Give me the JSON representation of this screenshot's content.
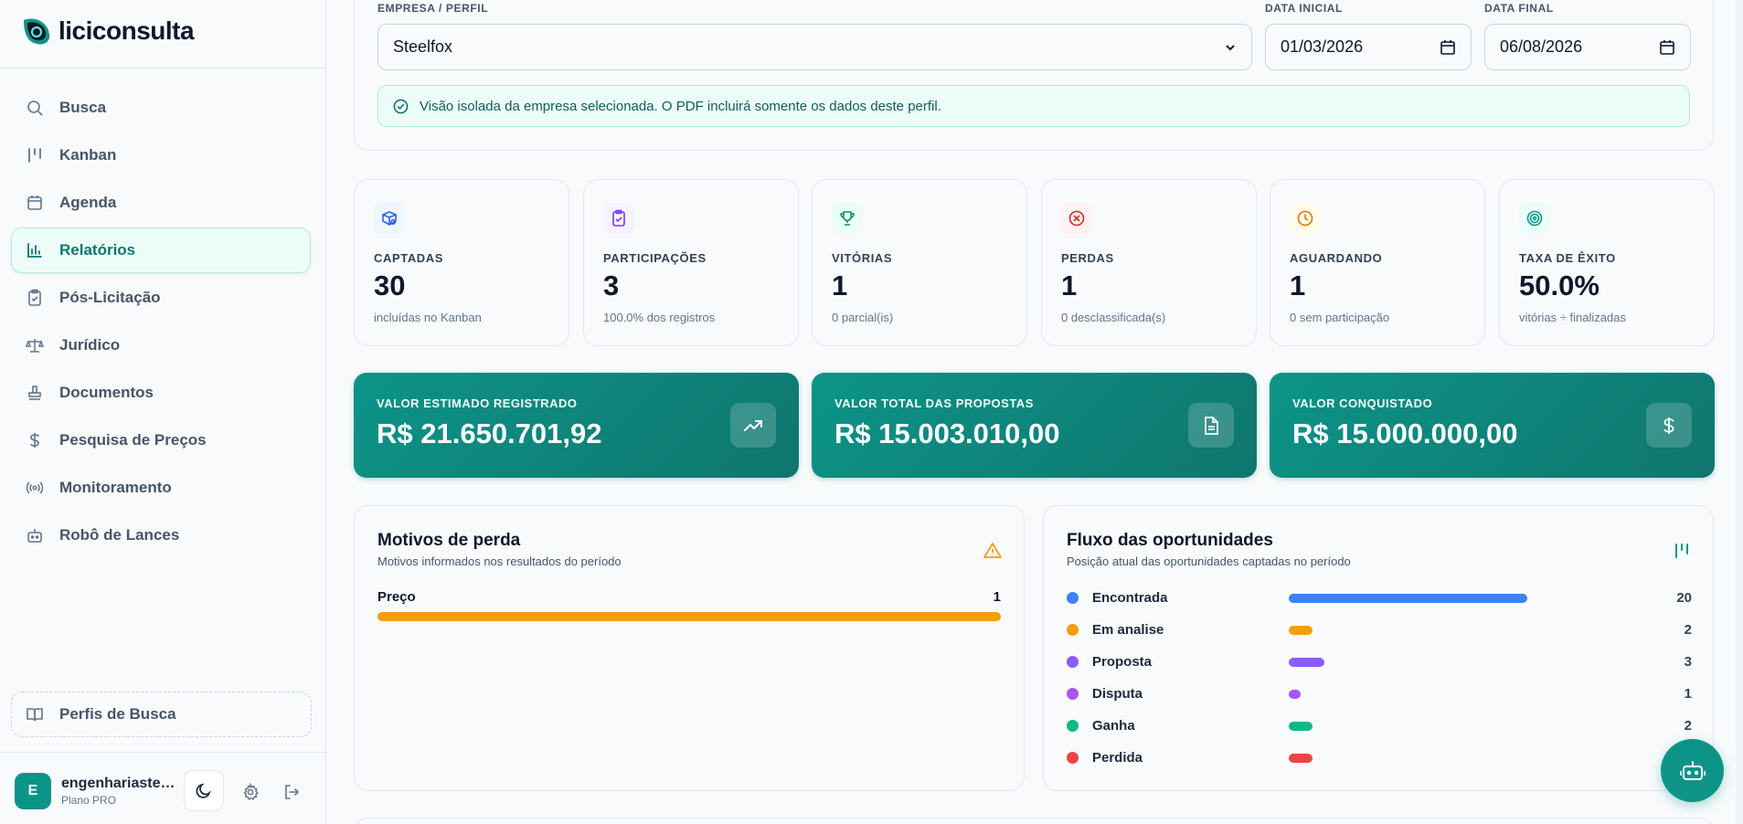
{
  "app": {
    "name": "liciconsulta"
  },
  "sidebar": {
    "items": [
      {
        "label": "Busca",
        "icon": "search-icon"
      },
      {
        "label": "Kanban",
        "icon": "kanban-icon"
      },
      {
        "label": "Agenda",
        "icon": "calendar-icon"
      },
      {
        "label": "Relatórios",
        "icon": "bar-chart-icon",
        "active": true
      },
      {
        "label": "Pós-Licitação",
        "icon": "clipboard-check-icon"
      },
      {
        "label": "Jurídico",
        "icon": "scale-icon"
      },
      {
        "label": "Documentos",
        "icon": "stamp-icon"
      },
      {
        "label": "Pesquisa de Preços",
        "icon": "dollar-icon"
      },
      {
        "label": "Monitoramento",
        "icon": "radio-icon"
      },
      {
        "label": "Robô de Lances",
        "icon": "bot-icon"
      }
    ],
    "perfis_label": "Perfis de Busca"
  },
  "user": {
    "initial": "E",
    "name": "engenhariasteelfox",
    "plan": "Plano PRO"
  },
  "filters": {
    "empresa_label": "EMPRESA / PERFIL",
    "empresa_value": "Steelfox",
    "data_inicial_label": "DATA INICIAL",
    "data_inicial_value": "01/03/2026",
    "data_final_label": "DATA FINAL",
    "data_final_value": "06/08/2026",
    "notice": "Visão isolada da empresa selecionada. O PDF incluirá somente os dados deste perfil."
  },
  "stats": [
    {
      "title": "CAPTADAS",
      "value": "30",
      "sub": "incluídas no Kanban",
      "icon": "package-search-icon",
      "color": "#2563eb",
      "bg": "#eff6ff"
    },
    {
      "title": "PARTICIPAÇÕES",
      "value": "3",
      "sub": "100.0% dos registros",
      "icon": "clipboard-check-icon",
      "color": "#7c3aed",
      "bg": "#f5f3ff"
    },
    {
      "title": "VITÓRIAS",
      "value": "1",
      "sub": "0 parcial(is)",
      "icon": "trophy-icon",
      "color": "#059669",
      "bg": "#ecfdf5"
    },
    {
      "title": "PERDAS",
      "value": "1",
      "sub": "0 desclassificada(s)",
      "icon": "x-circle-icon",
      "color": "#dc2626",
      "bg": "#fef2f2"
    },
    {
      "title": "AGUARDANDO",
      "value": "1",
      "sub": "0 sem participação",
      "icon": "clock-icon",
      "color": "#d97706",
      "bg": "#fffbeb"
    },
    {
      "title": "TAXA DE ÊXITO",
      "value": "50.0%",
      "sub": "vitórias ÷ finalizadas",
      "icon": "target-icon",
      "color": "#0d9488",
      "bg": "#ecfdf8"
    }
  ],
  "money": [
    {
      "title": "VALOR ESTIMADO REGISTRADO",
      "value": "R$ 21.650.701,92",
      "icon": "trending-up-icon"
    },
    {
      "title": "VALOR TOTAL DAS PROPOSTAS",
      "value": "R$ 15.003.010,00",
      "icon": "file-text-icon"
    },
    {
      "title": "VALOR CONQUISTADO",
      "value": "R$ 15.000.000,00",
      "icon": "dollar-icon"
    }
  ],
  "loss_panel": {
    "title": "Motivos de perda",
    "subtitle": "Motivos informados nos resultados do período",
    "rows": [
      {
        "name": "Preço",
        "count": "1",
        "fraction": 1.0
      }
    ]
  },
  "flow_panel": {
    "title": "Fluxo das oportunidades",
    "subtitle": "Posição atual das oportunidades captadas no período",
    "rows": [
      {
        "name": "Encontrada",
        "count": "20",
        "value": 20,
        "color": "#3b82f6"
      },
      {
        "name": "Em analise",
        "count": "2",
        "value": 2,
        "color": "#f59e0b"
      },
      {
        "name": "Proposta",
        "count": "3",
        "value": 3,
        "color": "#8b5cf6"
      },
      {
        "name": "Disputa",
        "count": "1",
        "value": 1,
        "color": "#a855f7"
      },
      {
        "name": "Ganha",
        "count": "2",
        "value": 2,
        "color": "#10b981"
      },
      {
        "name": "Perdida",
        "count": "",
        "value": 2,
        "color": "#ef4444"
      }
    ]
  }
}
